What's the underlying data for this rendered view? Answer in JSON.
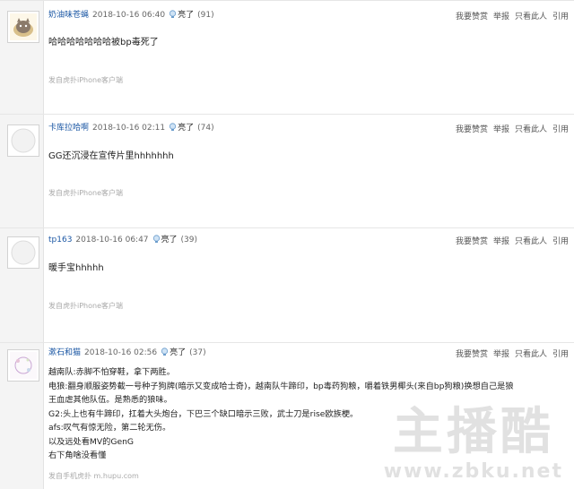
{
  "actions": {
    "recommend": "我要赞赏",
    "report": "举报",
    "only_this": "只看此人",
    "quote": "引用"
  },
  "posts": [
    {
      "user": "奶油味苍蝇",
      "time": "2018-10-16 06:40",
      "light": "亮了",
      "light_count": "(91)",
      "content": [
        "哈哈哈哈哈哈哈被bp毒死了"
      ],
      "source": "发自虎扑iPhone客户端"
    },
    {
      "user": "卡库拉哈啊",
      "time": "2018-10-16 02:11",
      "light": "亮了",
      "light_count": "(74)",
      "content": [
        "GG还沉浸在宣传片里hhhhhhh"
      ],
      "source": "发自虎扑iPhone客户端"
    },
    {
      "user": "tp163",
      "time": "2018-10-16 06:47",
      "light": "亮了",
      "light_count": "(39)",
      "content": [
        "暖手宝hhhhh"
      ],
      "source": "发自虎扑iPhone客户端"
    },
    {
      "user": "漱石和猫",
      "time": "2018-10-16 02:56",
      "light": "亮了",
      "light_count": "(37)",
      "content": [
        "越南队:赤脚不怕穿鞋，拿下两胜。",
        "电狼:翻身顺服姿势截一号种子狗牌(暗示又变成哈士奇)，越南队牛蹄印，bp毒药狗粮，嚼着铁男椰头(来自bp狗粮)换想自己是狼",
        "王血虐其他队伍。是熟悉的狼味。",
        "G2:头上也有牛蹄印，扛着大头炮台，下巴三个缺口暗示三败，武士刀是rise欧族梗。",
        "afs:叹气有惊无险，第二轮无伤。",
        "以及远处看MV的GenG",
        "右下角啥没看懂"
      ],
      "source": "发自手机虎扑 m.hupu.com"
    }
  ],
  "watermark": {
    "title": "主播酷",
    "url": "www.zbku.net"
  }
}
